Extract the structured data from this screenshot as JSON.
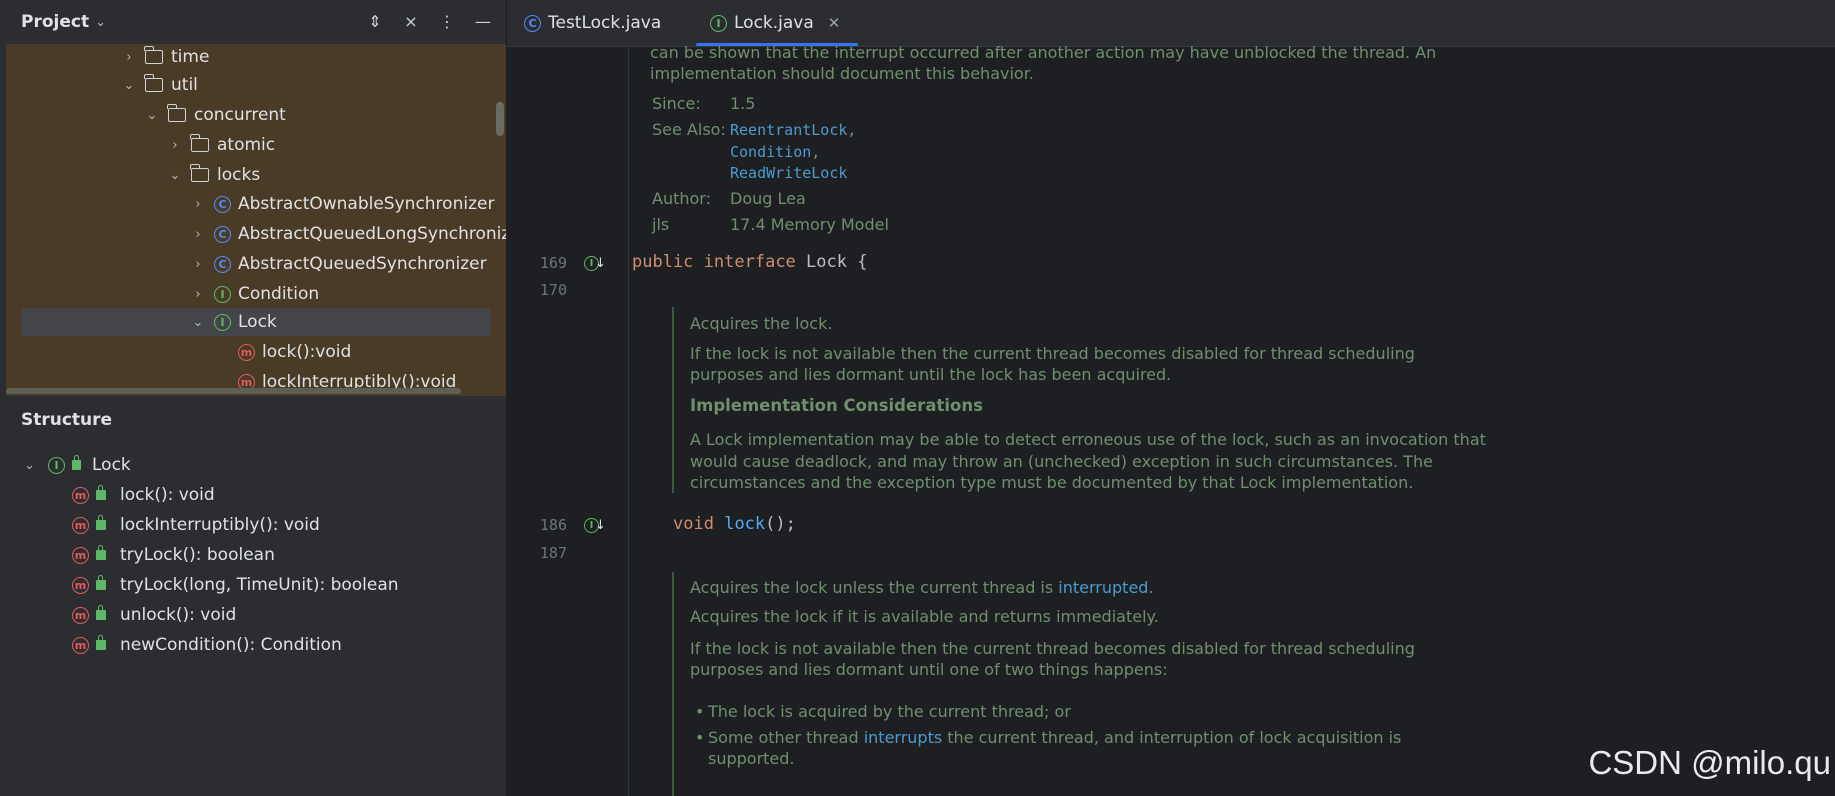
{
  "project_panel": {
    "title": "Project",
    "tree": [
      {
        "label": "time",
        "kind": "folder",
        "expanded": false
      },
      {
        "label": "util",
        "kind": "folder",
        "expanded": true
      },
      {
        "label": "concurrent",
        "kind": "folder",
        "expanded": true
      },
      {
        "label": "atomic",
        "kind": "folder",
        "expanded": false
      },
      {
        "label": "locks",
        "kind": "folder",
        "expanded": true
      },
      {
        "label": "AbstractOwnableSynchronizer",
        "kind": "class",
        "expanded": false
      },
      {
        "label": "AbstractQueuedLongSynchronizer",
        "kind": "class",
        "expanded": false
      },
      {
        "label": "AbstractQueuedSynchronizer",
        "kind": "class",
        "expanded": false
      },
      {
        "label": "Condition",
        "kind": "interface",
        "expanded": false
      },
      {
        "label": "Lock",
        "kind": "interface",
        "expanded": true
      },
      {
        "label": "lock():void",
        "kind": "method"
      },
      {
        "label": "lockInterruptibly():void",
        "kind": "method"
      }
    ]
  },
  "structure_panel": {
    "title": "Structure",
    "root": "Lock",
    "members": [
      "lock(): void",
      "lockInterruptibly(): void",
      "tryLock(): boolean",
      "tryLock(long, TimeUnit): boolean",
      "unlock(): void",
      "newCondition(): Condition"
    ]
  },
  "tabs": [
    {
      "label": "TestLock.java",
      "icon": "class-icon",
      "active": false
    },
    {
      "label": "Lock.java",
      "icon": "interface-icon",
      "active": true
    }
  ],
  "editor": {
    "doc_top": {
      "line1": "can be shown that the interrupt occurred after another action may have unblocked the thread. An",
      "line2": "implementation should document this behavior.",
      "since_key": "Since:",
      "since_val": "1.5",
      "see_also_key": "See Also:",
      "see_also": [
        "ReentrantLock",
        "Condition",
        "ReadWriteLock"
      ],
      "author_key": "Author:",
      "author_val": "Doug Lea",
      "jls_key": "jls",
      "jls_val": "17.4 Memory Model"
    },
    "lines": {
      "l169": "169",
      "l170": "170",
      "l186": "186",
      "l187": "187"
    },
    "decl": {
      "kw1": "public",
      "kw2": "interface",
      "name": "Lock",
      "rest": " {"
    },
    "lock_decl": {
      "kw": "void",
      "name": "lock",
      "rest": "();"
    },
    "doc_lock": {
      "p1": "Acquires the lock.",
      "p2a": "If the lock is not available then the current thread becomes disabled for thread scheduling",
      "p2b": "purposes and lies dormant until the lock has been acquired.",
      "h": "Implementation Considerations",
      "p3a": "A Lock implementation may be able to detect erroneous use of the lock, such as an invocation that",
      "p3b": "would cause deadlock, and may throw an (unchecked) exception in such circumstances. The",
      "p3c": "circumstances and the exception type must be documented by that Lock implementation."
    },
    "doc_interruptibly": {
      "p1a": "Acquires the lock unless the current thread is ",
      "p1link": "interrupted",
      "p1b": ".",
      "p2": "Acquires the lock if it is available and returns immediately.",
      "p3a": "If the lock is not available then the current thread becomes disabled for thread scheduling",
      "p3b": "purposes and lies dormant until one of two things happens:",
      "b1": "The lock is acquired by the current thread; or",
      "b2a": "Some other thread ",
      "b2link": "interrupts",
      "b2b": " the current thread, and interruption of lock acquisition is",
      "b2c": "supported."
    }
  },
  "watermark": "CSDN @milo.qu"
}
